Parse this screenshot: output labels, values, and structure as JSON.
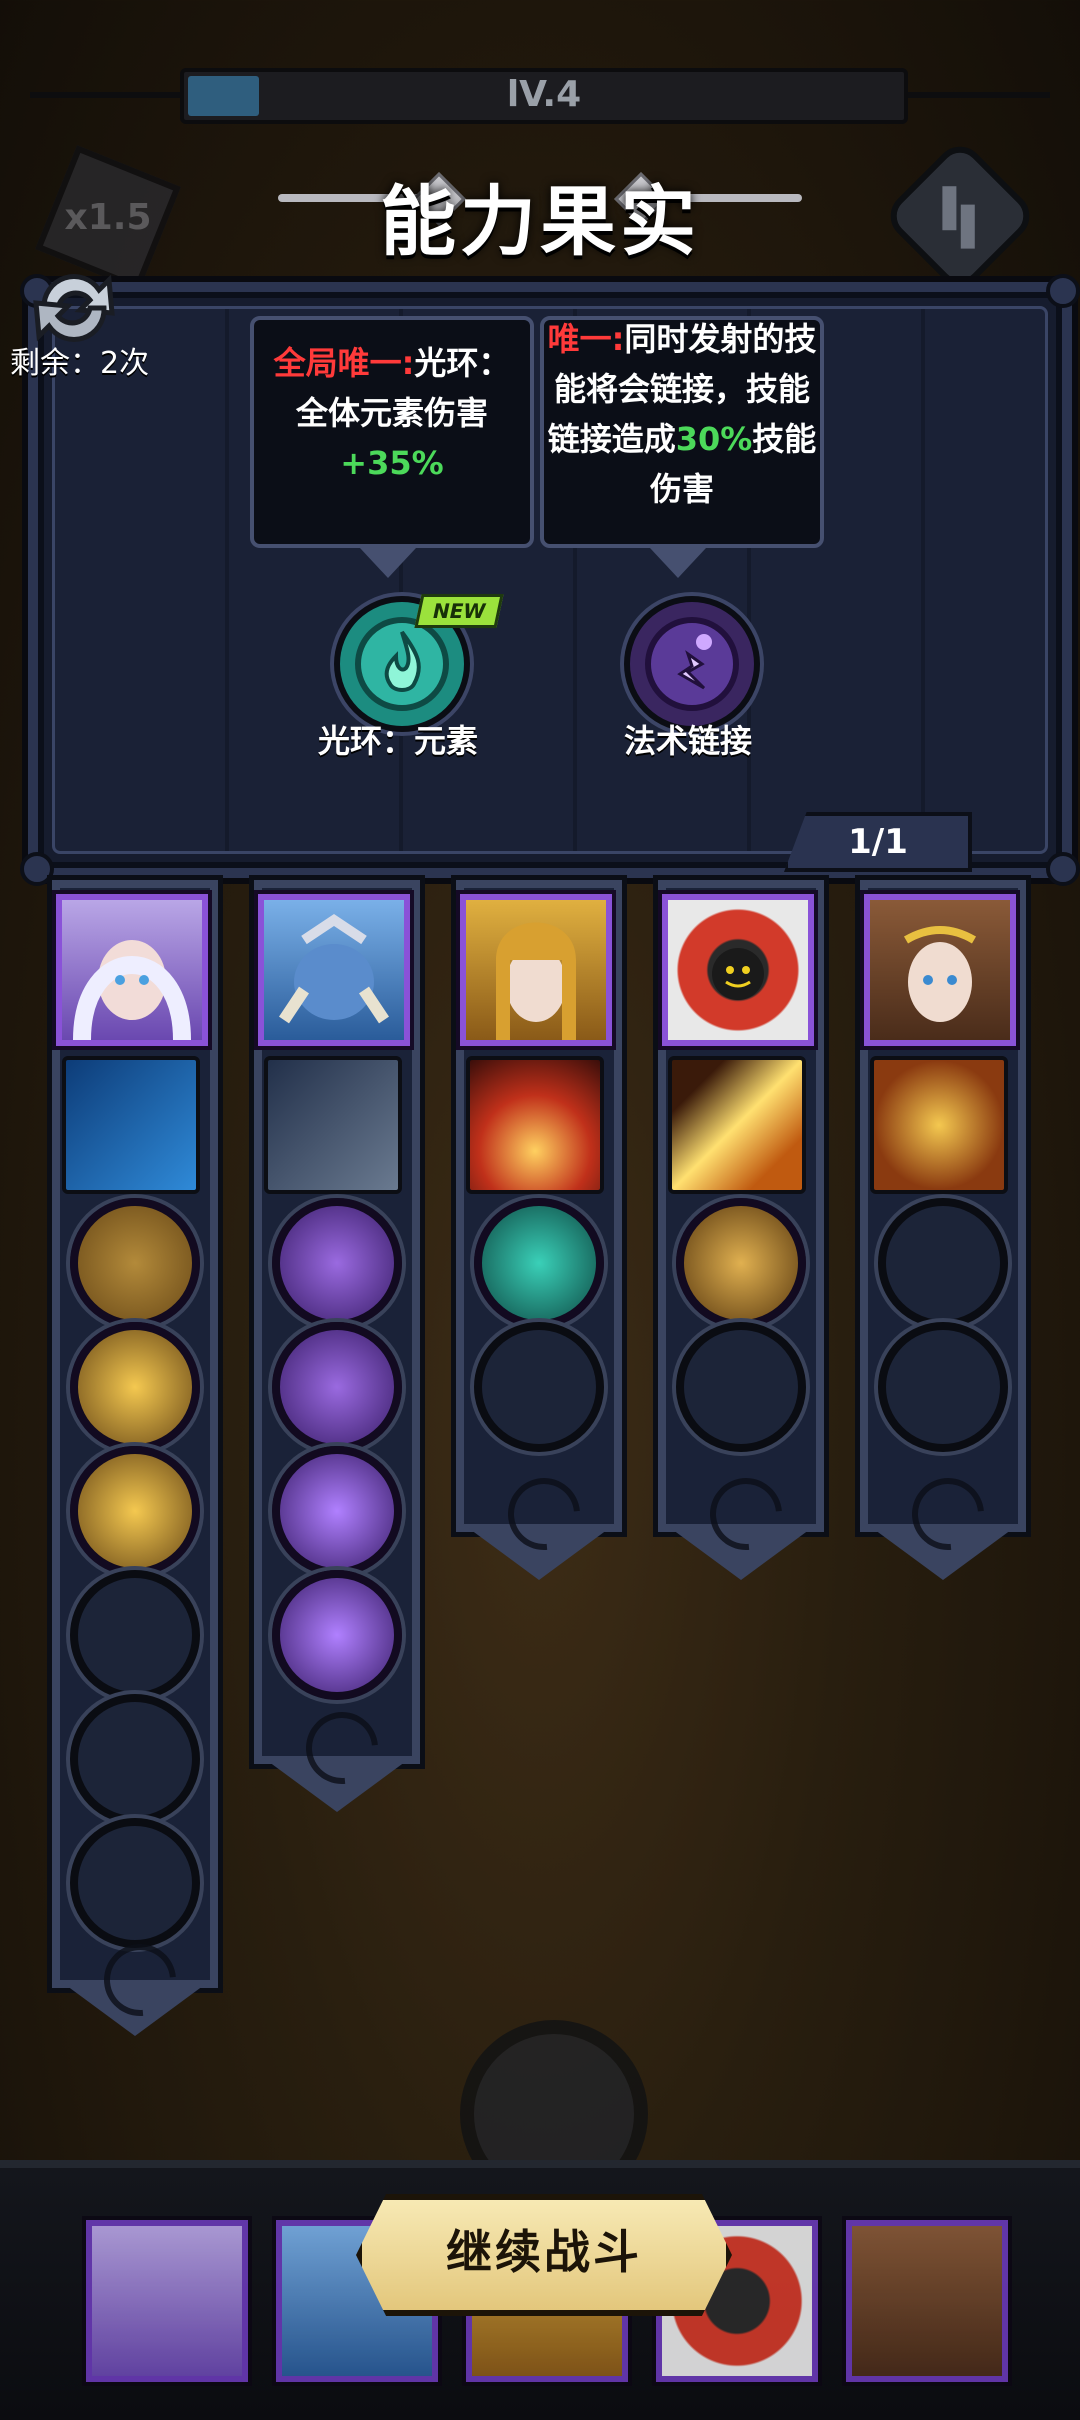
{
  "level_label": "lV.4",
  "level_progress": 0.1,
  "title": "能力果实",
  "speed_label": "x1.5",
  "refresh_remaining": "剩余：2次",
  "choices": [
    {
      "desc_tag": "全局唯一:",
      "desc_line1": "光环：",
      "desc_line2": "全体元素伤害",
      "desc_value": "+35%",
      "name": "光环：元素",
      "is_new": true,
      "new_label": "NEW",
      "icon": "green-flame-aura-icon"
    },
    {
      "desc_tag": "唯一:",
      "desc_line1": "同时发射的技",
      "desc_line2": "能将会链接，技能",
      "desc_line3_pre": "链接造成",
      "desc_value": "30%",
      "desc_line3_post": "技能",
      "desc_line4": "伤害",
      "name": "法术链接",
      "is_new": false,
      "icon": "purple-lightning-chain-icon"
    }
  ],
  "page_indicator": "1/1",
  "heroes": [
    {
      "name": "white-haired-sorceress",
      "weapon": "ice-crystal",
      "slots": [
        "gold-arrow",
        "gold-burst",
        "gold-burst",
        "",
        "",
        ""
      ]
    },
    {
      "name": "blue-horned-demon",
      "weapon": "battle-axe",
      "slots": [
        "purple-swirl",
        "purple-orbs",
        "purple-arrow",
        "purple-arrow"
      ]
    },
    {
      "name": "golden-helm-queen",
      "weapon": "fire-pit",
      "slots": [
        "teal-swirl",
        ""
      ]
    },
    {
      "name": "red-robot",
      "weapon": "light-beam",
      "slots": [
        "gold-spiral",
        ""
      ]
    },
    {
      "name": "laurel-goddess",
      "weapon": "gold-medallion",
      "slots": [
        "",
        ""
      ]
    }
  ],
  "continue_label": "继续战斗",
  "colors": {
    "accent_red": "#ff3a3a",
    "accent_green": "#4cd95a",
    "rare_purple": "#8a52d8"
  }
}
